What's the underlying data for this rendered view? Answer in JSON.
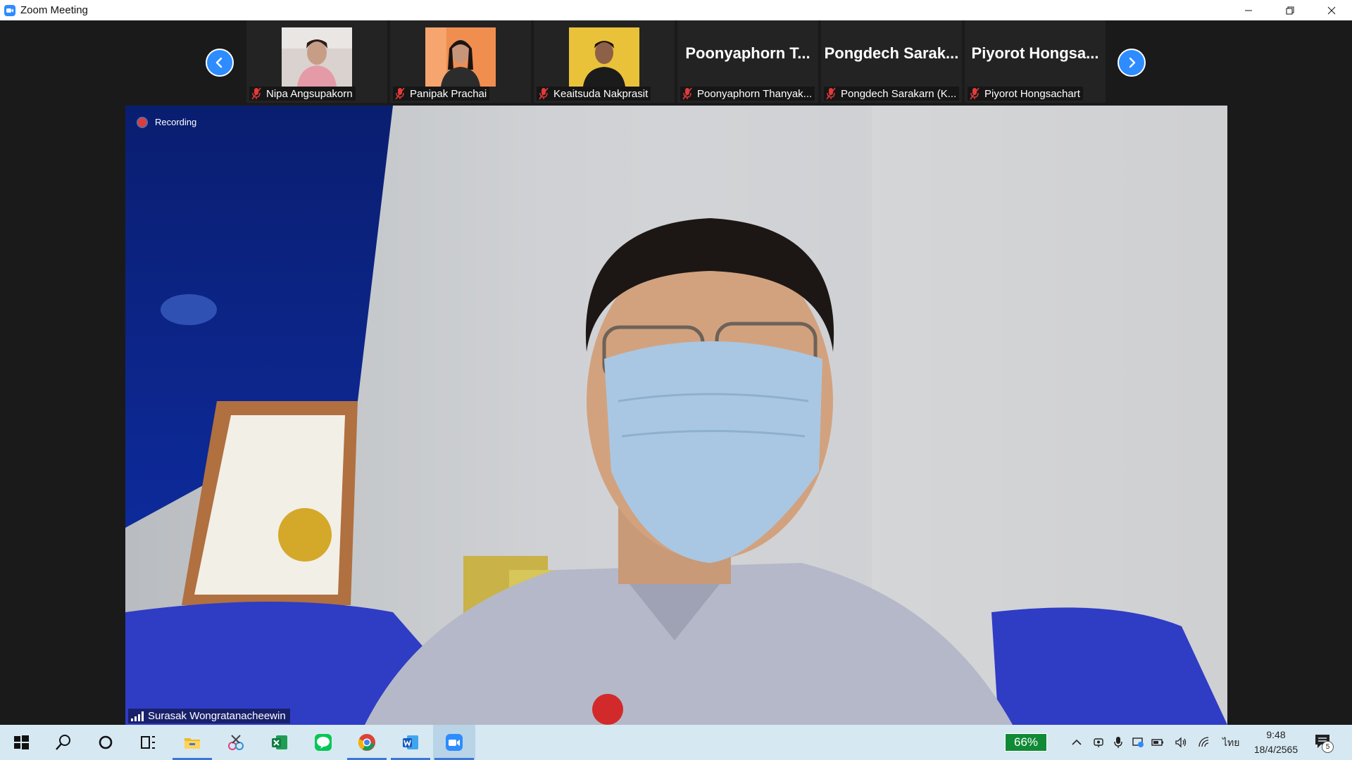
{
  "window": {
    "title": "Zoom Meeting",
    "controls": [
      "minimize",
      "restore",
      "close"
    ]
  },
  "strip": {
    "prev_icon": "chevron-left-icon",
    "next_icon": "chevron-right-icon",
    "participants": [
      {
        "name": "Nipa Angsupakorn",
        "video": true,
        "muted": true
      },
      {
        "name": "Panipak Prachai",
        "video": true,
        "muted": true
      },
      {
        "name": "Keaitsuda Nakprasit",
        "video": true,
        "muted": true
      },
      {
        "name": "Poonyaphorn Thanyak...",
        "display_name": "Poonyaphorn T...",
        "video": false,
        "muted": true
      },
      {
        "name": "Pongdech Sarakarn (K...",
        "display_name": "Pongdech Sarak...",
        "video": false,
        "muted": true
      },
      {
        "name": "Piyorot Hongsachart",
        "display_name": "Piyorot Hongsa...",
        "video": false,
        "muted": true
      }
    ]
  },
  "main": {
    "recording_label": "Recording",
    "speaker_name": "Surasak Wongratanacheewin"
  },
  "taskbar": {
    "apps": [
      "windows-start-icon",
      "search-icon",
      "cortana-icon",
      "task-view-icon",
      "file-explorer-icon",
      "snip-icon",
      "excel-icon",
      "line-icon",
      "chrome-icon",
      "word-icon",
      "zoom-icon"
    ],
    "battery_badge": "66%",
    "language": "ไทย",
    "time": "9:48",
    "date": "18/4/2565",
    "notification_count": "5"
  },
  "colors": {
    "zoom_blue": "#2d8cff",
    "taskbar_bg": "#d6e8f2",
    "battery_green": "#0f8a35",
    "recording_red": "#e03b3b"
  }
}
